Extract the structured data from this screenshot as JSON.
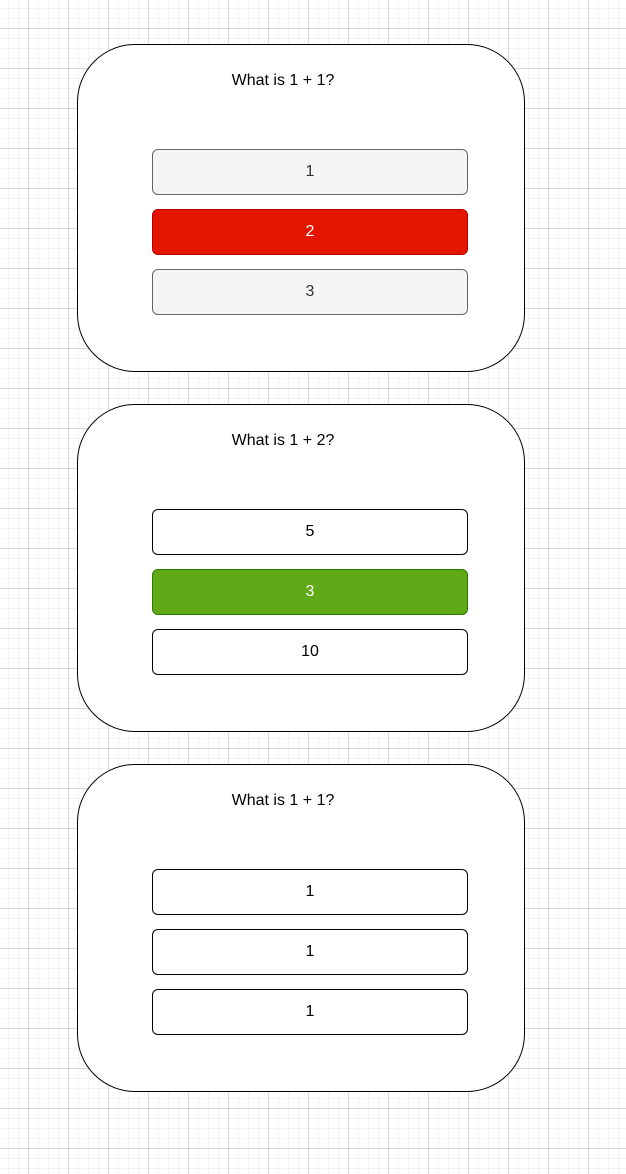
{
  "colors": {
    "wrong": "#e51400",
    "wrong_border": "#b20000",
    "correct": "#60a917",
    "correct_border": "#2d7600",
    "neutral": "#f5f5f5",
    "neutral_border": "#666666",
    "default": "#ffffff",
    "default_border": "#000000"
  },
  "cards": [
    {
      "question": "What is 1 + 1?",
      "options": [
        {
          "label": "1",
          "state": "neutral"
        },
        {
          "label": "2",
          "state": "wrong"
        },
        {
          "label": "3",
          "state": "neutral"
        }
      ]
    },
    {
      "question": "What is 1 + 2?",
      "options": [
        {
          "label": "5",
          "state": "default"
        },
        {
          "label": "3",
          "state": "correct"
        },
        {
          "label": "10",
          "state": "default"
        }
      ]
    },
    {
      "question": "What is 1 + 1?",
      "options": [
        {
          "label": "1",
          "state": "default"
        },
        {
          "label": "1",
          "state": "default"
        },
        {
          "label": "1",
          "state": "default"
        }
      ]
    }
  ]
}
